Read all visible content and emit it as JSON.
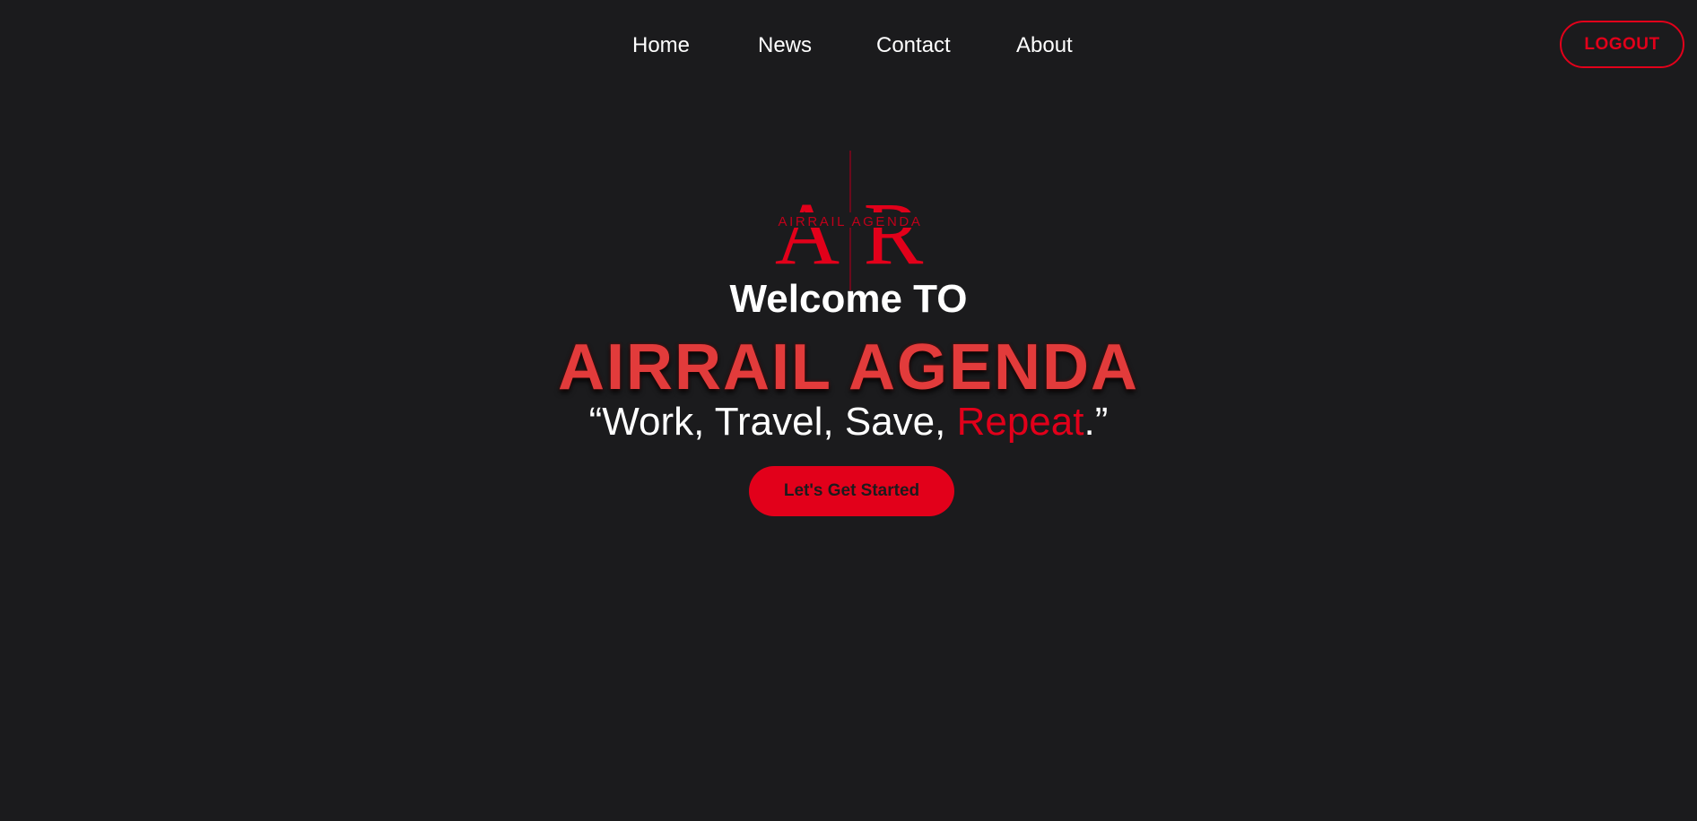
{
  "nav": {
    "links": [
      {
        "label": "Home"
      },
      {
        "label": "News"
      },
      {
        "label": "Contact"
      },
      {
        "label": "About"
      }
    ],
    "logout_label": "LOGOUT"
  },
  "logo": {
    "letters": "AR",
    "wordmark": "AIRRAIL AGENDA",
    "icon": "ar-monogram-logo"
  },
  "hero": {
    "welcome": "Welcome TO",
    "title": "AIRRAIL AGENDA",
    "tagline_prefix": "“Work, Travel, Save, ",
    "tagline_accent": "Repeat",
    "tagline_suffix": ".”",
    "cta_label": "Let's Get Started"
  },
  "colors": {
    "background": "#1b1b1d",
    "accent": "#e2001a",
    "title": "#e23b3b",
    "text": "#ffffff"
  }
}
